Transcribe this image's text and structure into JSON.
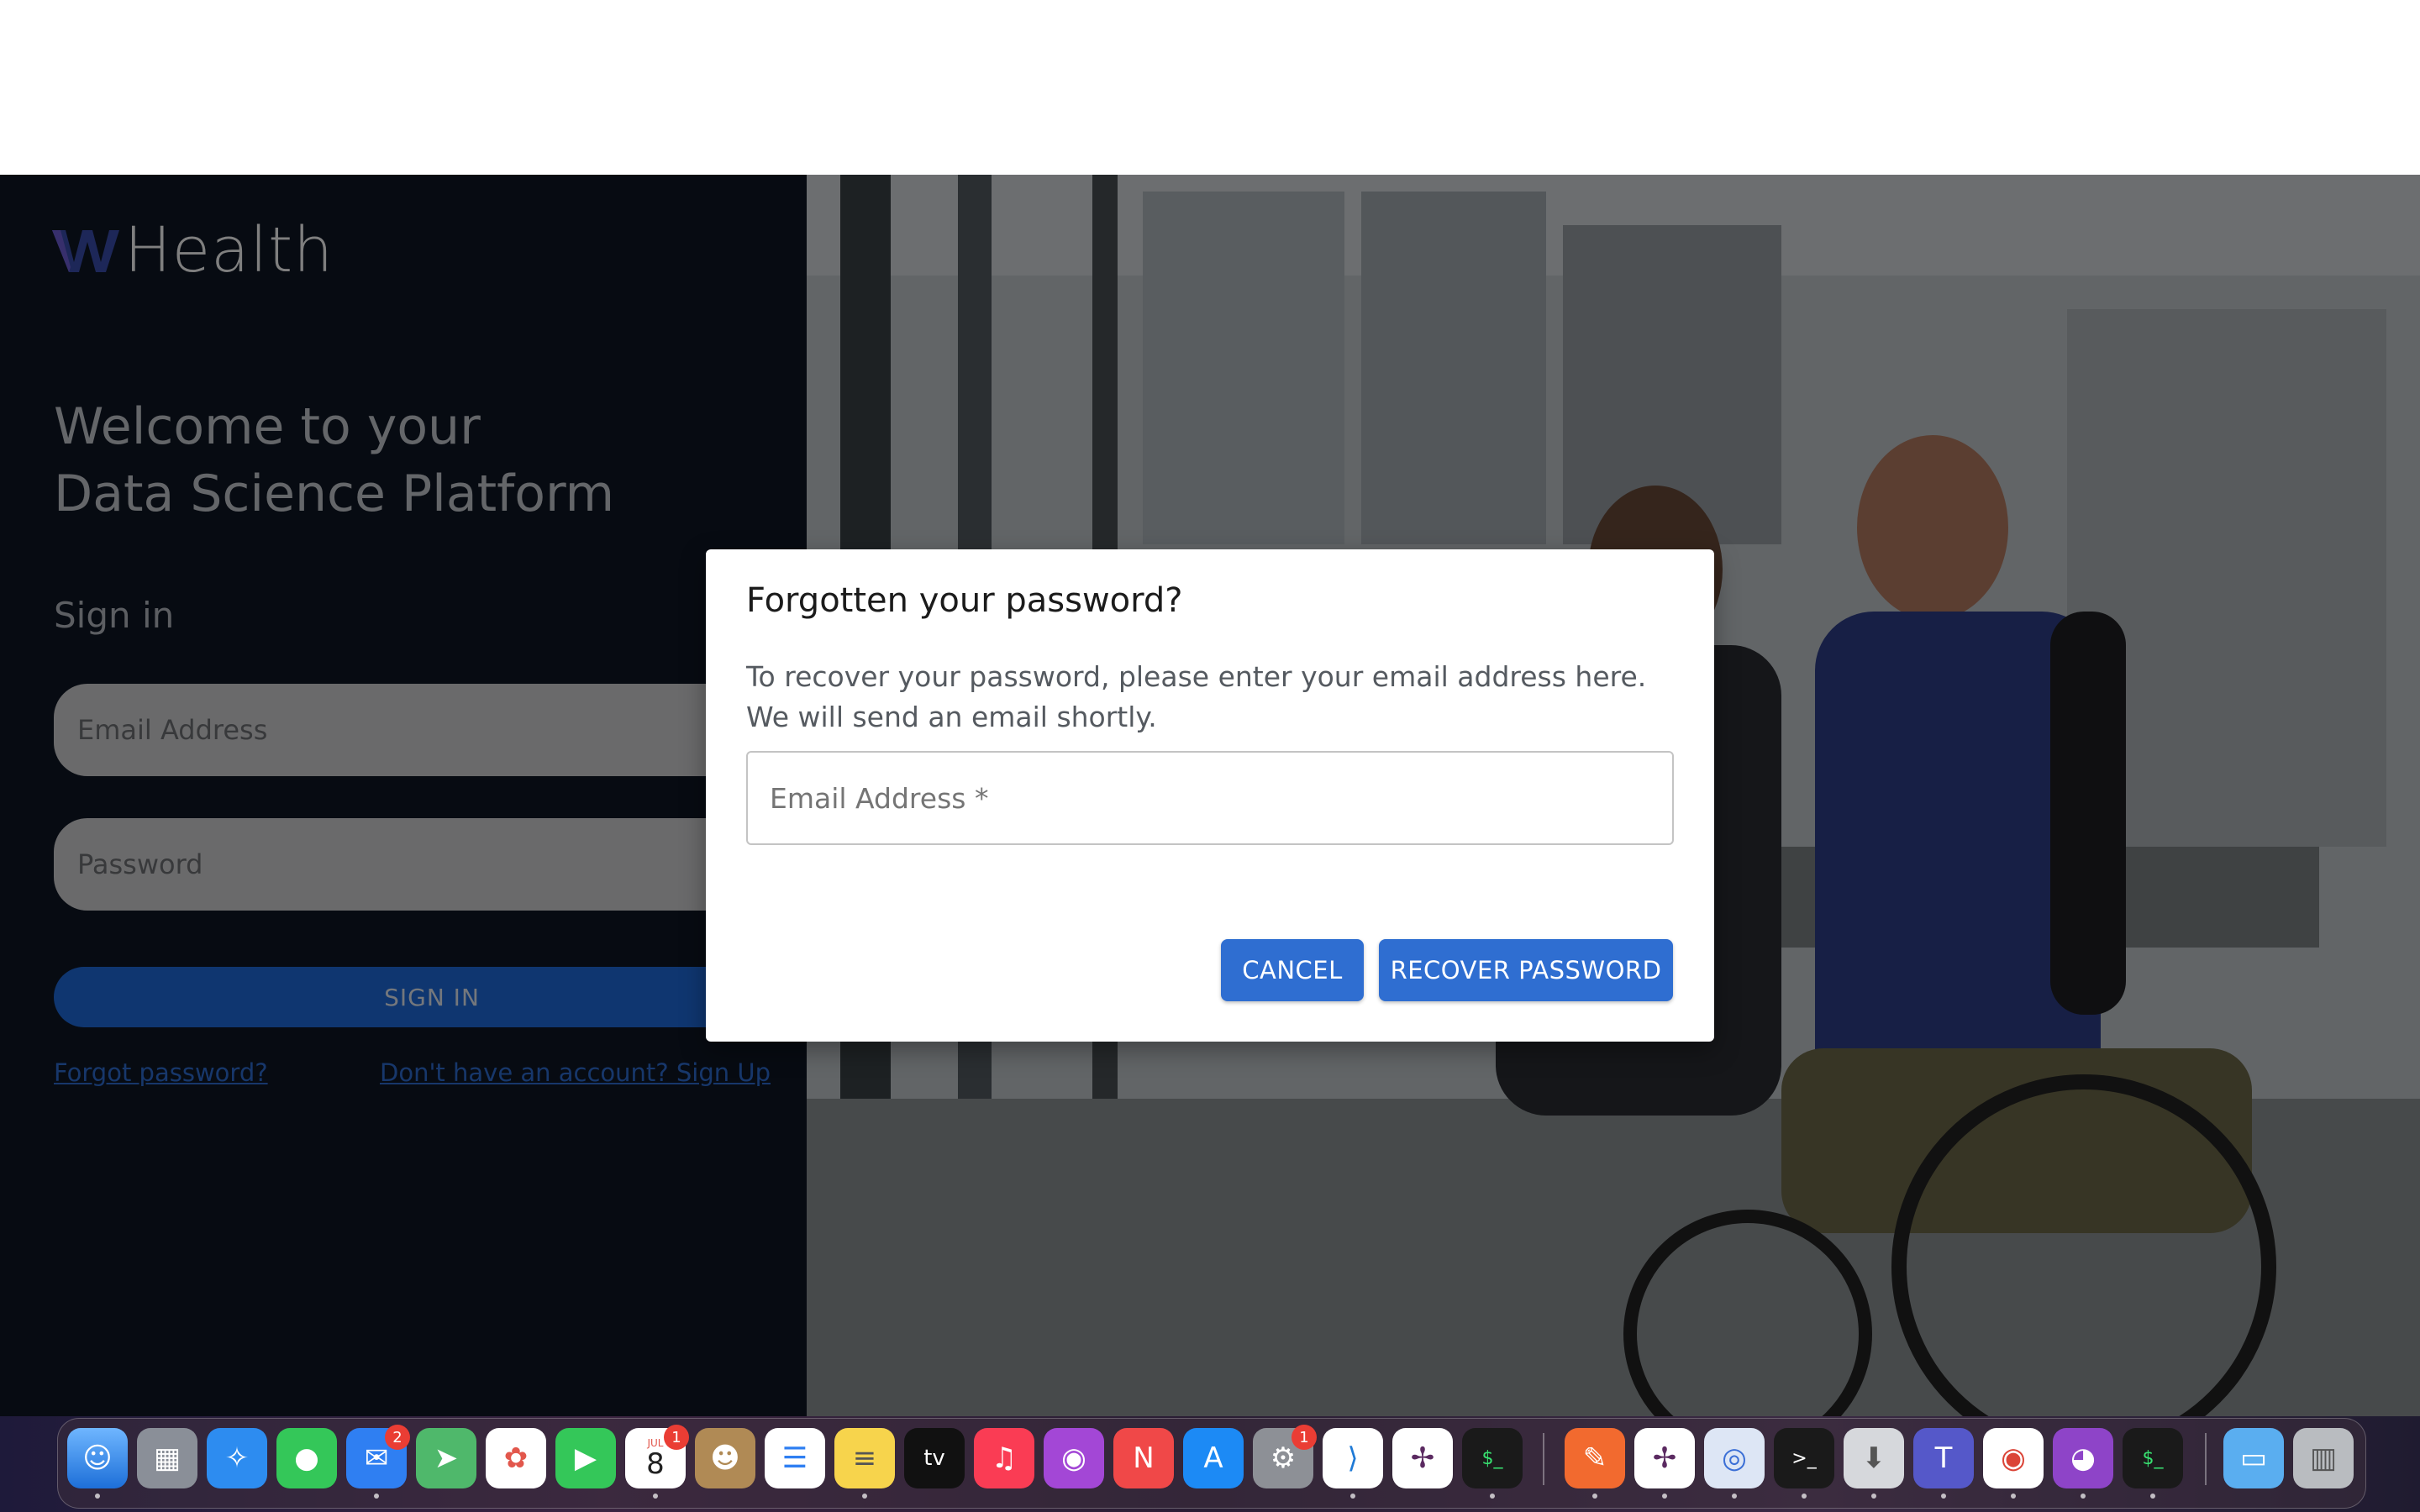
{
  "app": {
    "logo_text": "Health",
    "welcome_line1": "Welcome to your",
    "welcome_line2": "Data Science Platform",
    "signin_title": "Sign in",
    "email_placeholder": "Email Address",
    "password_placeholder": "Password",
    "signin_button": "SIGN IN",
    "forgot_link": "Forgot password?",
    "signup_link": "Don't have an account? Sign Up"
  },
  "modal": {
    "title": "Forgotten your password?",
    "body": "To recover your password, please enter your email address here. We will send an email shortly.",
    "email_placeholder": "Email Address *",
    "cancel_label": "CANCEL",
    "recover_label": "RECOVER PASSWORD"
  },
  "colors": {
    "accent": "#2f6ed1",
    "left_panel": "#0f1724"
  },
  "dock": {
    "calendar_month": "JUL",
    "calendar_day": "8",
    "appletv_label": "tv",
    "badges": {
      "mail": "2",
      "calendar": "1",
      "settings": "1"
    },
    "icons": [
      "finder-icon",
      "launchpad-icon",
      "safari-icon",
      "messages-icon",
      "mail-icon",
      "maps-icon",
      "photos-icon",
      "facetime-icon",
      "calendar-icon",
      "contacts-icon",
      "reminders-icon",
      "notes-icon",
      "appletv-icon",
      "music-icon",
      "podcasts-icon",
      "news-icon",
      "appstore-icon",
      "system-settings-icon",
      "vscode-icon",
      "slack-icon",
      "terminal-icon",
      "pen-icon",
      "slack-icon",
      "chrome-alt-icon",
      "terminal-icon",
      "disk-utility-icon",
      "teams-icon",
      "chrome-icon",
      "github-icon",
      "terminal-icon",
      "folder-icon",
      "trash-icon"
    ]
  }
}
